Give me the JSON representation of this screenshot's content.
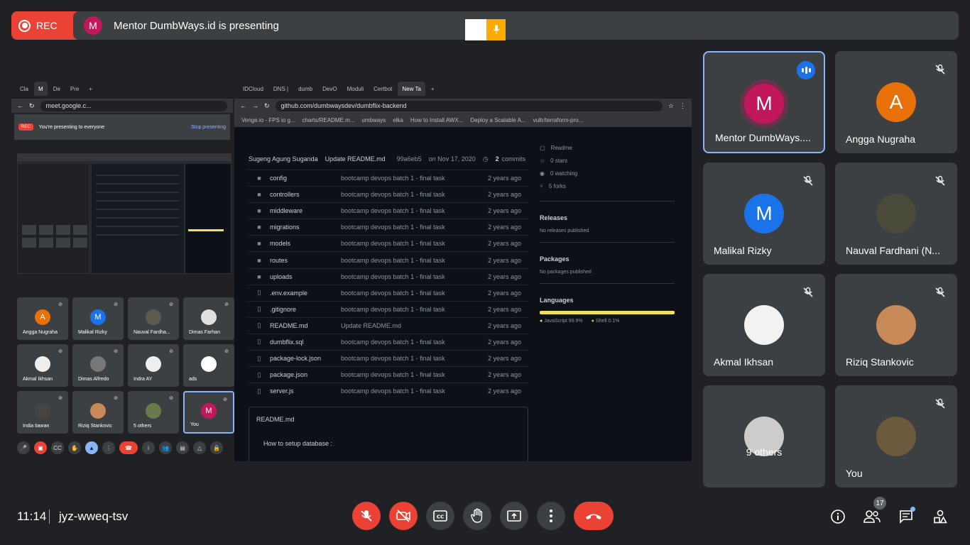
{
  "top": {
    "rec_label": "REC",
    "presenter_initial": "M",
    "presenting_text": "Mentor DumbWays.id is presenting"
  },
  "shared_screen": {
    "left_browser": {
      "tabs": [
        "Cla",
        "M",
        "De",
        "Pre"
      ],
      "url": "meet.google.c...",
      "presenting_notice": "You're presenting to everyone",
      "stop_presenting": "Stop presenting",
      "rec": "REC",
      "tiles": [
        {
          "name": "Angga Nugraha",
          "initial": "A",
          "color": "#e8710a"
        },
        {
          "name": "Malikal Rizky",
          "initial": "M",
          "color": "#1a73e8"
        },
        {
          "name": "Nauval Fardha...",
          "initial": "",
          "color": "#5d5a4d"
        },
        {
          "name": "Dimas Farhan",
          "initial": "",
          "color": "#e0e0e0"
        },
        {
          "name": "Akmal Ikhsan",
          "initial": "",
          "color": "#eeeeee"
        },
        {
          "name": "Dimas Alfredo",
          "initial": "",
          "color": "#777777"
        },
        {
          "name": "Indra AY",
          "initial": "",
          "color": "#eeeeee"
        },
        {
          "name": "ads",
          "initial": "",
          "color": "#ffffff"
        },
        {
          "name": "India tiawan",
          "initial": "",
          "color": "#444444"
        },
        {
          "name": "Riziq Stankovic",
          "initial": "",
          "color": "#c98a5a"
        },
        {
          "name": "5 others",
          "initial": "",
          "color": "#6a7a4a"
        },
        {
          "name": "You",
          "initial": "M",
          "color": "#c2185b"
        }
      ]
    },
    "right_browser": {
      "tabs": [
        "IDCloud",
        "DNS |",
        "dumb",
        "DevO",
        "Moduli",
        "Certbot",
        "New Ta"
      ],
      "url": "github.com/dumbwaysdev/dumbflix-backend",
      "bookmarks": [
        "Venge.io - FPS io g...",
        "charts/README.m...",
        "umbways",
        "elka",
        "How to Install AWX...",
        "Deploy a Scalable A...",
        "vultr/terraform-pro..."
      ],
      "commit": {
        "author": "Sugeng Agung Suganda",
        "message": "Update README.md",
        "hash": "99a6eb5",
        "date": "on Nov 17, 2020",
        "commits_count": "2",
        "commits_label": "commits"
      },
      "files": [
        {
          "icon": "folder",
          "name": "config",
          "msg": "bootcamp devops batch 1 - final task",
          "age": "2 years ago"
        },
        {
          "icon": "folder",
          "name": "controllers",
          "msg": "bootcamp devops batch 1 - final task",
          "age": "2 years ago"
        },
        {
          "icon": "folder",
          "name": "middleware",
          "msg": "bootcamp devops batch 1 - final task",
          "age": "2 years ago"
        },
        {
          "icon": "folder",
          "name": "migrations",
          "msg": "bootcamp devops batch 1 - final task",
          "age": "2 years ago"
        },
        {
          "icon": "folder",
          "name": "models",
          "msg": "bootcamp devops batch 1 - final task",
          "age": "2 years ago"
        },
        {
          "icon": "folder",
          "name": "routes",
          "msg": "bootcamp devops batch 1 - final task",
          "age": "2 years ago"
        },
        {
          "icon": "folder",
          "name": "uploads",
          "msg": "bootcamp devops batch 1 - final task",
          "age": "2 years ago"
        },
        {
          "icon": "file",
          "name": ".env.example",
          "msg": "bootcamp devops batch 1 - final task",
          "age": "2 years ago"
        },
        {
          "icon": "file",
          "name": ".gitignore",
          "msg": "bootcamp devops batch 1 - final task",
          "age": "2 years ago"
        },
        {
          "icon": "file",
          "name": "README.md",
          "msg": "Update README.md",
          "age": "2 years ago"
        },
        {
          "icon": "file",
          "name": "dumbflix.sql",
          "msg": "bootcamp devops batch 1 - final task",
          "age": "2 years ago"
        },
        {
          "icon": "file",
          "name": "package-lock.json",
          "msg": "bootcamp devops batch 1 - final task",
          "age": "2 years ago"
        },
        {
          "icon": "file",
          "name": "package.json",
          "msg": "bootcamp devops batch 1 - final task",
          "age": "2 years ago"
        },
        {
          "icon": "file",
          "name": "server.js",
          "msg": "bootcamp devops batch 1 - final task",
          "age": "2 years ago"
        }
      ],
      "readme_title": "README.md",
      "readme_line": "How to setup database :",
      "sidebar": {
        "readme": "Readme",
        "stars": "0 stars",
        "watching": "0 watching",
        "forks": "5 forks",
        "releases_title": "Releases",
        "releases_sub": "No releases published",
        "packages_title": "Packages",
        "packages_sub": "No packages published",
        "languages_title": "Languages",
        "lang_js": "JavaScript 99.9%",
        "lang_shell": "Shell 0.1%"
      }
    }
  },
  "participants": [
    {
      "name": "Mentor DumbWays....",
      "initial": "M",
      "color": "#c2185b",
      "speaking": true
    },
    {
      "name": "Angga Nugraha",
      "initial": "A",
      "color": "#e8710a",
      "muted": true
    },
    {
      "name": "Malikal Rizky",
      "initial": "M",
      "color": "#1a73e8",
      "muted": true
    },
    {
      "name": "Nauval Fardhani (N...",
      "initial": "",
      "color": "#4a4a3a",
      "muted": true
    },
    {
      "name": "Akmal Ikhsan",
      "initial": "",
      "color": "#f2f2f2",
      "muted": true
    },
    {
      "name": "Riziq Stankovic",
      "initial": "",
      "color": "#c98a5a",
      "muted": true
    },
    {
      "name": "9 others",
      "initial": "",
      "color": "#cccccc"
    },
    {
      "name": "You",
      "initial": "",
      "color": "#6b5a3e",
      "muted": true
    }
  ],
  "bottom": {
    "time": "11:14",
    "meeting_code": "jyz-wweq-tsv",
    "people_count": "17"
  }
}
